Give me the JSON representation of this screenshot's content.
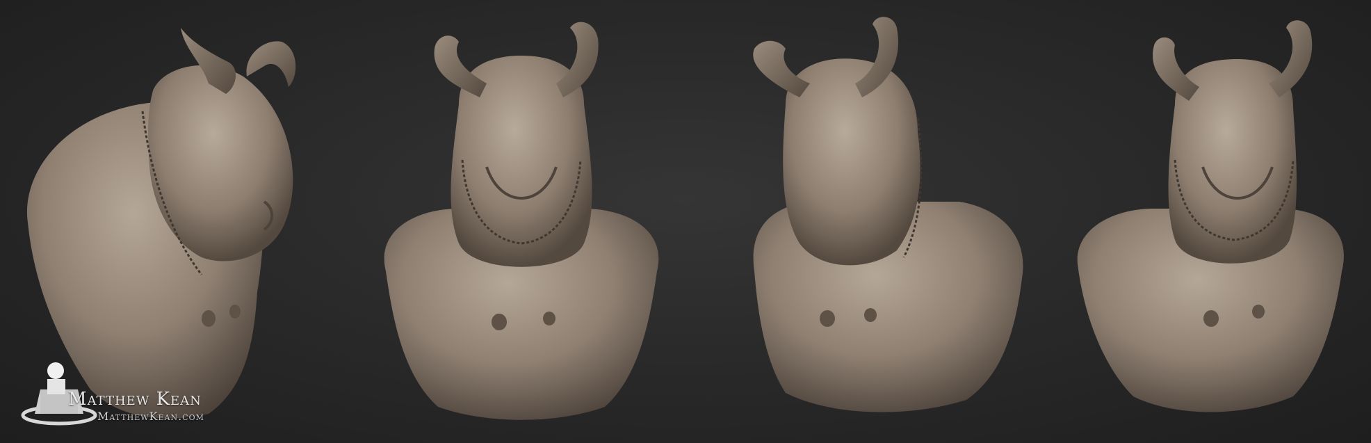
{
  "watermark": {
    "name": "Matthew Kean",
    "url": "MatthewKean.com"
  },
  "render": {
    "views": [
      "left-three-quarter",
      "front",
      "right-three-quarter",
      "front-alt"
    ]
  },
  "colors": {
    "background": "#2a2a2a",
    "clay": "#8f8072",
    "clay_light": "#b3a595",
    "clay_dark": "#5e5247",
    "horn": "#6e6258"
  }
}
